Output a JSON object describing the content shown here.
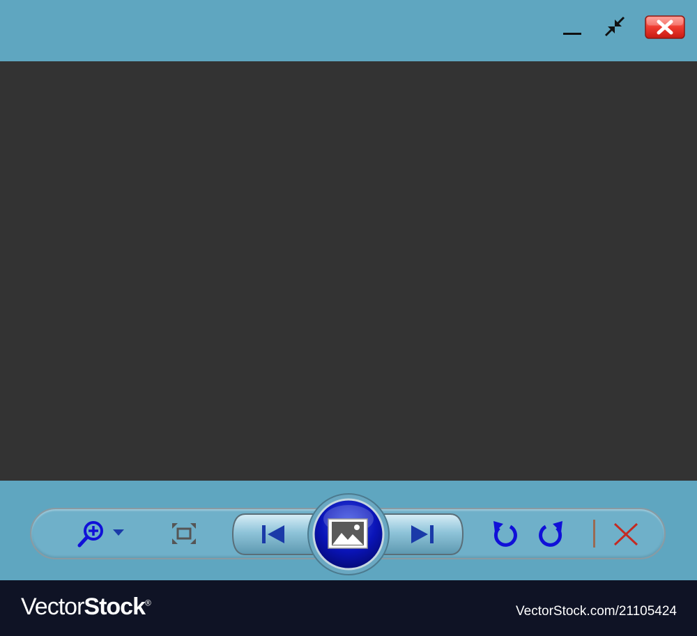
{
  "window": {
    "controls": [
      "minimize-icon",
      "restore-icon",
      "close-icon"
    ],
    "close_color": "#e8352f"
  },
  "viewer": {
    "background": "#333333"
  },
  "toolbar": {
    "tools": [
      {
        "name": "zoom-in",
        "icon": "zoom-in-icon",
        "has_dropdown": true
      },
      {
        "name": "fit-to-window",
        "icon": "fit-window-icon"
      },
      {
        "name": "previous",
        "icon": "skip-previous-icon"
      },
      {
        "name": "slideshow",
        "icon": "image-icon"
      },
      {
        "name": "next",
        "icon": "skip-next-icon"
      },
      {
        "name": "rotate-left",
        "icon": "rotate-counterclockwise-icon"
      },
      {
        "name": "rotate-right",
        "icon": "rotate-clockwise-icon"
      },
      {
        "name": "delete",
        "icon": "delete-x-icon"
      }
    ],
    "accent": "#1010d8",
    "pill_color": "#6fb0c9"
  },
  "watermark": {
    "brand_part1": "Vector",
    "brand_part2": "Stock",
    "brand_mark": "®",
    "stock_id": "VectorStock.com/21105424"
  }
}
